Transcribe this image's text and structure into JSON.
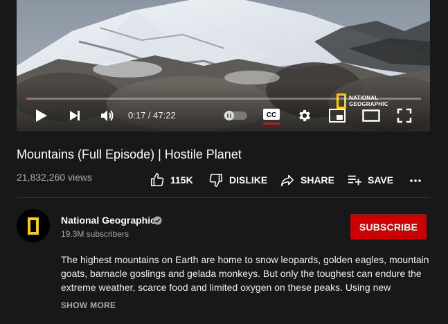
{
  "player": {
    "time_display": "0:17 / 47:22",
    "progress_fraction": 0.006,
    "watermark_text": "NATIONAL\nGEOGRAPHIC",
    "progress_color": "#ff0000"
  },
  "video": {
    "title": "Mountains (Full Episode) | Hostile Planet",
    "views": "21,832,260 views"
  },
  "actions": {
    "like_count": "115K",
    "dislike_label": "DISLIKE",
    "share_label": "SHARE",
    "save_label": "SAVE"
  },
  "channel": {
    "name": "National Geographic",
    "subscribers": "19.3M subscribers",
    "subscribe_label": "SUBSCRIBE",
    "brand_color": "#ffcc00",
    "subscribe_color": "#cc0000"
  },
  "description": {
    "text": "The highest mountains on Earth are home to snow leopards, golden eagles, mountain goats, barnacle goslings and gelada monkeys. But only the toughest can endure the extreme weather, scarce food and limited oxygen on these peaks. Using new",
    "show_more_label": "SHOW MORE"
  },
  "icons": {
    "play": "play-icon",
    "next": "next-icon",
    "volume": "volume-icon",
    "autoplay": "autoplay-toggle-icon",
    "captions": "captions-icon",
    "settings": "gear-icon",
    "miniplayer": "miniplayer-icon",
    "theater": "theater-icon",
    "fullscreen": "fullscreen-icon",
    "like": "thumbs-up-icon",
    "dislike": "thumbs-down-icon",
    "share": "share-icon",
    "save": "playlist-add-icon",
    "more": "more-horizontal-icon",
    "verified": "verified-check-icon"
  }
}
